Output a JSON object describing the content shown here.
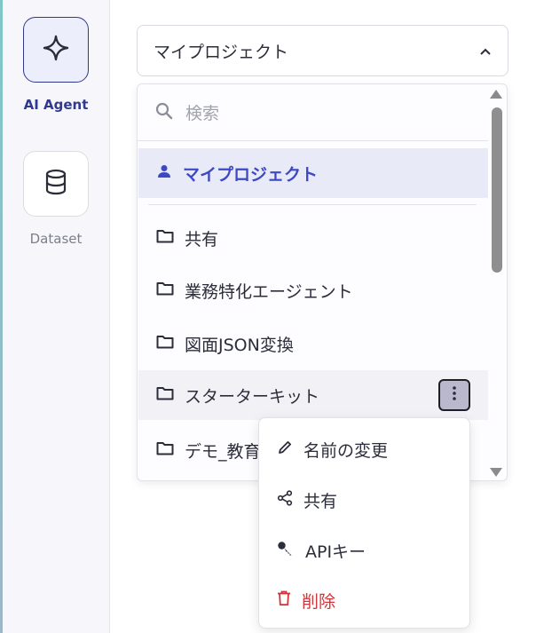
{
  "sidebar": {
    "items": [
      {
        "label": "AI Agent",
        "icon": "sparkle-icon",
        "active": true
      },
      {
        "label": "Dataset",
        "icon": "database-icon",
        "active": false
      }
    ]
  },
  "project_select": {
    "value": "マイプロジェクト",
    "icon": "chevron-up-icon"
  },
  "dropdown": {
    "search_placeholder": "検索",
    "selected": {
      "label": "マイプロジェクト",
      "icon": "person-icon"
    },
    "folders": [
      {
        "label": "共有",
        "icon": "folder-icon"
      },
      {
        "label": "業務特化エージェント",
        "icon": "folder-icon"
      },
      {
        "label": "図面JSON変換",
        "icon": "folder-icon"
      },
      {
        "label": "スターターキット",
        "icon": "folder-icon",
        "hovered": true
      },
      {
        "label": "デモ_教育",
        "icon": "folder-icon"
      }
    ]
  },
  "context_menu": {
    "items": [
      {
        "label": "名前の変更",
        "icon": "pencil-icon"
      },
      {
        "label": "共有",
        "icon": "share-icon"
      },
      {
        "label": "APIキー",
        "icon": "key-icon"
      },
      {
        "label": "削除",
        "icon": "trash-icon",
        "danger": true
      }
    ]
  },
  "colors": {
    "accent": "#3d49c4",
    "active_nav": "#2f3a8f",
    "danger": "#d0353a",
    "selected_bg": "#e8eaf7"
  }
}
